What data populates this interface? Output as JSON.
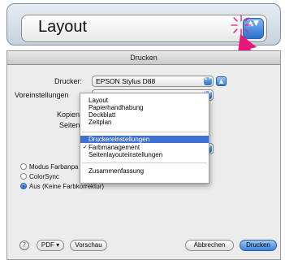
{
  "zoom": {
    "label": "Layout",
    "arrows": "▲▼"
  },
  "dialog": {
    "title": "Drucken",
    "printer_label": "Drucker:",
    "printer_value": "EPSON Stylus D88",
    "presets_label": "Voreinstellungen",
    "copies_label": "Kopien",
    "pages_label": "Seiten",
    "square_button": "▲",
    "popup_arrows": "▲▼"
  },
  "menu": {
    "items_top": [
      "Layout",
      "Papierhandhabung",
      "Deckblatt",
      "Zeitplan"
    ],
    "items_mid": [
      "Druckereinstellungen",
      "Farbmanagement",
      "Seitenlayouteinstellungen"
    ],
    "items_bottom": [
      "Zusammenfassung"
    ],
    "selected": "Druckereinstellungen",
    "checked": "Farbmanagement",
    "check_mark": "✓"
  },
  "color_options": {
    "items": [
      "Modus Farbanpa",
      "ColorSync",
      "Aus (Keine Farbkorrektur)"
    ],
    "selected_index": 2
  },
  "footer": {
    "help": "?",
    "pdf": "PDF ▾",
    "preview": "Vorschau",
    "cancel": "Abbrechen",
    "print": "Drucken"
  },
  "colors": {
    "accent": "#3e71d2",
    "callout": "#e8177a"
  }
}
